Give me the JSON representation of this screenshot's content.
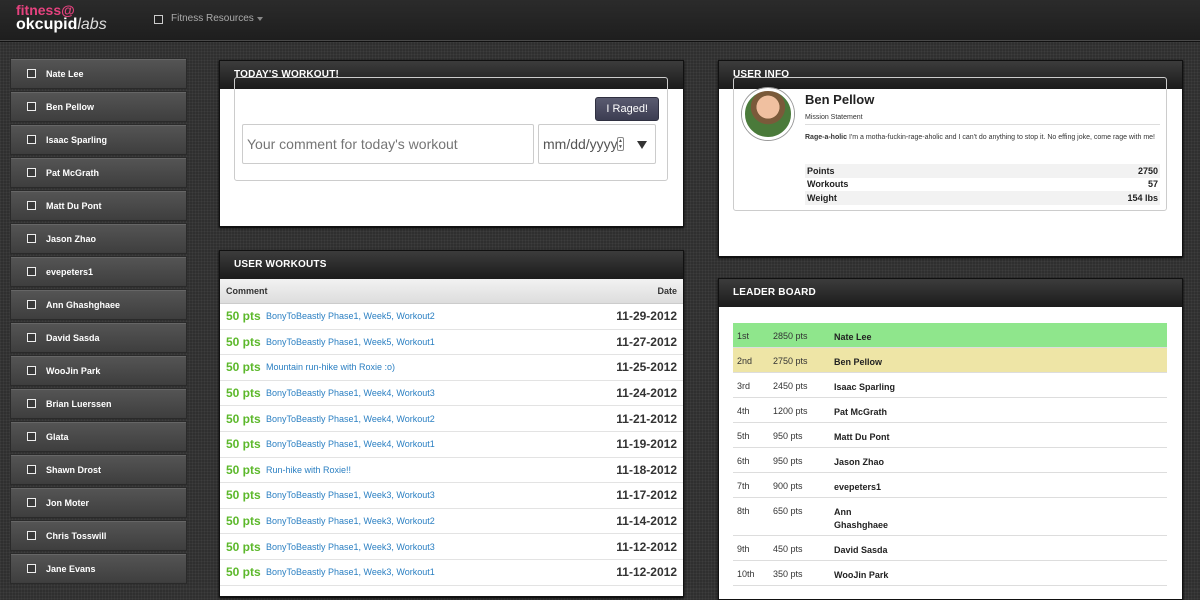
{
  "brand": {
    "top": "fitness@",
    "bold": "okcupid",
    "italic": "labs"
  },
  "nav": {
    "resources_label": "Fitness Resources"
  },
  "sidebar": {
    "items": [
      {
        "label": "Nate Lee"
      },
      {
        "label": "Ben Pellow"
      },
      {
        "label": "Isaac Sparling"
      },
      {
        "label": "Pat McGrath"
      },
      {
        "label": "Matt Du Pont"
      },
      {
        "label": "Jason Zhao"
      },
      {
        "label": "evepeters1"
      },
      {
        "label": "Ann Ghashghaee"
      },
      {
        "label": "David Sasda"
      },
      {
        "label": "WooJin Park"
      },
      {
        "label": "Brian Luerssen"
      },
      {
        "label": "Glata"
      },
      {
        "label": "Shawn Drost"
      },
      {
        "label": "Jon Moter"
      },
      {
        "label": "Chris Tosswill"
      },
      {
        "label": "Jane Evans"
      }
    ]
  },
  "todays_workout": {
    "title": "Today's Workout!",
    "raged_button": "I Raged!",
    "comment_placeholder": "Your comment for today's workout",
    "date_placeholder": "mm/dd/yyyy"
  },
  "user_workouts": {
    "title": "User Workouts",
    "columns": {
      "comment": "Comment",
      "date": "Date"
    },
    "rows": [
      {
        "pts": "50 pts",
        "comment": "BonyToBeastly Phase1, Week5, Workout2",
        "date": "11-29-2012"
      },
      {
        "pts": "50 pts",
        "comment": "BonyToBeastly Phase1, Week5, Workout1",
        "date": "11-27-2012"
      },
      {
        "pts": "50 pts",
        "comment": "Mountain run-hike with Roxie :o)",
        "date": "11-25-2012"
      },
      {
        "pts": "50 pts",
        "comment": "BonyToBeastly Phase1, Week4, Workout3",
        "date": "11-24-2012"
      },
      {
        "pts": "50 pts",
        "comment": "BonyToBeastly Phase1, Week4, Workout2",
        "date": "11-21-2012"
      },
      {
        "pts": "50 pts",
        "comment": "BonyToBeastly Phase1, Week4, Workout1",
        "date": "11-19-2012"
      },
      {
        "pts": "50 pts",
        "comment": "Run-hike with Roxie!!",
        "date": "11-18-2012"
      },
      {
        "pts": "50 pts",
        "comment": "BonyToBeastly Phase1, Week3, Workout3",
        "date": "11-17-2012"
      },
      {
        "pts": "50 pts",
        "comment": "BonyToBeastly Phase1, Week3, Workout2",
        "date": "11-14-2012"
      },
      {
        "pts": "50 pts",
        "comment": "BonyToBeastly Phase1, Week3, Workout3",
        "date": "11-12-2012"
      },
      {
        "pts": "50 pts",
        "comment": "BonyToBeastly Phase1, Week3, Workout1",
        "date": "11-12-2012"
      }
    ]
  },
  "user_info": {
    "title": "User Info",
    "name": "Ben Pellow",
    "mission_label": "Mission Statement",
    "statement_bold": "Rage-a-holic",
    "statement_text": " I'm a motha-fuckin-rage-aholic and I can't do anything to stop it. No effing joke, come rage with me!",
    "stats": [
      {
        "label": "Points",
        "value": "2750"
      },
      {
        "label": "Workouts",
        "value": "57"
      },
      {
        "label": "Weight",
        "value": "154 lbs"
      }
    ]
  },
  "leader_board": {
    "title": "Leader Board",
    "rows": [
      {
        "rank": "1st",
        "pts": "2850 pts",
        "name": "Nate Lee"
      },
      {
        "rank": "2nd",
        "pts": "2750 pts",
        "name": "Ben Pellow"
      },
      {
        "rank": "3rd",
        "pts": "2450 pts",
        "name": "Isaac Sparling"
      },
      {
        "rank": "4th",
        "pts": "1200 pts",
        "name": "Pat McGrath"
      },
      {
        "rank": "5th",
        "pts": "950 pts",
        "name": "Matt Du Pont"
      },
      {
        "rank": "6th",
        "pts": "950 pts",
        "name": "Jason Zhao"
      },
      {
        "rank": "7th",
        "pts": "900 pts",
        "name": "evepeters1"
      },
      {
        "rank": "8th",
        "pts": "650 pts",
        "name": "Ann Ghashghaee"
      },
      {
        "rank": "9th",
        "pts": "450 pts",
        "name": "David Sasda"
      },
      {
        "rank": "10th",
        "pts": "350 pts",
        "name": "WooJin Park"
      }
    ]
  },
  "colors": {
    "brand_pink": "#e6427f",
    "points_green": "#5cb82b",
    "link_blue": "#2a7fc2",
    "leader_first": "#8fe68c",
    "leader_second": "#eee5a6"
  }
}
